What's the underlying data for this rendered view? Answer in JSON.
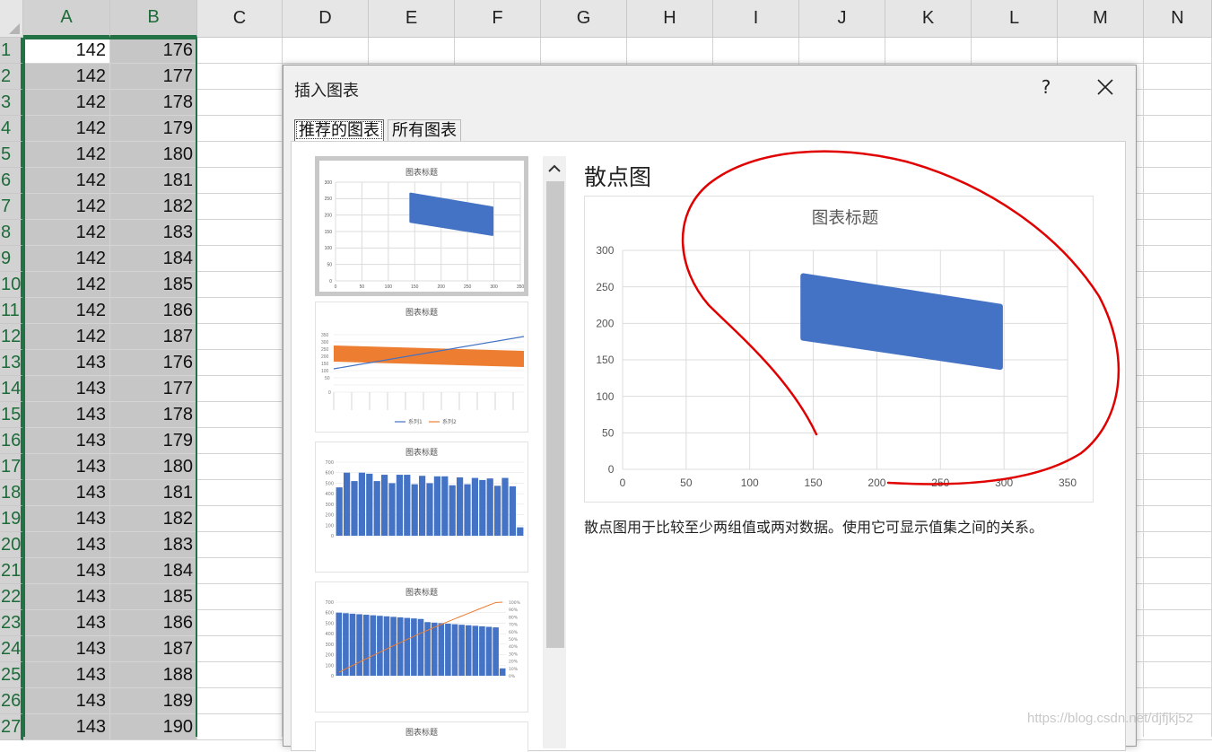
{
  "sheet": {
    "columns": [
      "A",
      "B",
      "C",
      "D",
      "E",
      "F",
      "G",
      "H",
      "I",
      "J",
      "K",
      "L",
      "M",
      "N"
    ],
    "rows": [
      {
        "n": "1",
        "a": "142",
        "b": "176"
      },
      {
        "n": "2",
        "a": "142",
        "b": "177"
      },
      {
        "n": "3",
        "a": "142",
        "b": "178"
      },
      {
        "n": "4",
        "a": "142",
        "b": "179"
      },
      {
        "n": "5",
        "a": "142",
        "b": "180"
      },
      {
        "n": "6",
        "a": "142",
        "b": "181"
      },
      {
        "n": "7",
        "a": "142",
        "b": "182"
      },
      {
        "n": "8",
        "a": "142",
        "b": "183"
      },
      {
        "n": "9",
        "a": "142",
        "b": "184"
      },
      {
        "n": "10",
        "a": "142",
        "b": "185"
      },
      {
        "n": "11",
        "a": "142",
        "b": "186"
      },
      {
        "n": "12",
        "a": "142",
        "b": "187"
      },
      {
        "n": "13",
        "a": "143",
        "b": "176"
      },
      {
        "n": "14",
        "a": "143",
        "b": "177"
      },
      {
        "n": "15",
        "a": "143",
        "b": "178"
      },
      {
        "n": "16",
        "a": "143",
        "b": "179"
      },
      {
        "n": "17",
        "a": "143",
        "b": "180"
      },
      {
        "n": "18",
        "a": "143",
        "b": "181"
      },
      {
        "n": "19",
        "a": "143",
        "b": "182"
      },
      {
        "n": "20",
        "a": "143",
        "b": "183"
      },
      {
        "n": "21",
        "a": "143",
        "b": "184"
      },
      {
        "n": "22",
        "a": "143",
        "b": "185"
      },
      {
        "n": "23",
        "a": "143",
        "b": "186"
      },
      {
        "n": "24",
        "a": "143",
        "b": "187"
      },
      {
        "n": "25",
        "a": "143",
        "b": "188"
      },
      {
        "n": "26",
        "a": "143",
        "b": "189"
      },
      {
        "n": "27",
        "a": "143",
        "b": "190"
      }
    ]
  },
  "dialog": {
    "title": "插入图表",
    "help": "?",
    "tabs": [
      "推荐的图表",
      "所有图表"
    ],
    "thumbnails": [
      {
        "title": "图表标题",
        "kind": "scatter"
      },
      {
        "title": "图表标题",
        "kind": "line",
        "legend": [
          "系列1",
          "系列2"
        ]
      },
      {
        "title": "图表标题",
        "kind": "histogram"
      },
      {
        "title": "图表标题",
        "kind": "pareto"
      },
      {
        "title": "图表标题",
        "kind": "more"
      }
    ],
    "preview": {
      "title": "散点图",
      "description": "散点图用于比较至少两组值或两对数据。使用它可显示值集之间的关系。"
    }
  },
  "chart_data": {
    "type": "scatter",
    "title": "图表标题",
    "xlim": [
      0,
      350
    ],
    "ylim": [
      0,
      300
    ],
    "x_ticks": [
      "0",
      "50",
      "100",
      "150",
      "200",
      "250",
      "300",
      "350"
    ],
    "y_ticks": [
      "0",
      "50",
      "100",
      "150",
      "200",
      "250",
      "300"
    ],
    "grid": true,
    "color": "#4472c4",
    "cluster_corners": [
      [
        142,
        265
      ],
      [
        297,
        223
      ],
      [
        297,
        140
      ],
      [
        142,
        180
      ]
    ]
  },
  "watermark": "https://blog.csdn.net/djfjkj52",
  "colors": {
    "accent": "#217346",
    "series": "#4472c4",
    "series2": "#ed7d31",
    "annotation": "#e00000"
  }
}
